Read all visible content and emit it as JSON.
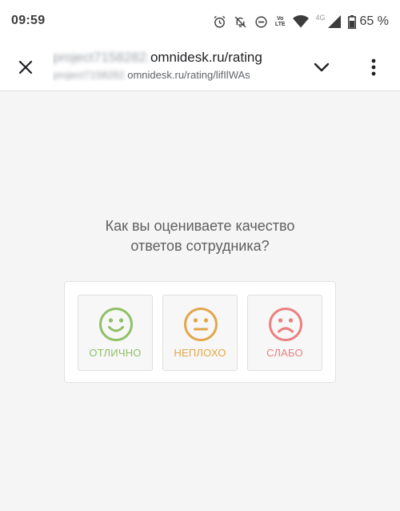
{
  "status": {
    "time": "09:59",
    "lte_top": "Vo",
    "lte_bottom": "LTE",
    "network": "4G",
    "battery": "65 %"
  },
  "toolbar": {
    "url_blurred_1": "project7158282.",
    "url_domain": "omnidesk.ru/rating",
    "url_blurred_2": "project7158282.",
    "url_path": "omnidesk.ru/rating/lifIlWAs"
  },
  "survey": {
    "question_line1": "Как вы оцениваете качество",
    "question_line2": "ответов сотрудника?",
    "options": [
      {
        "label": "ОТЛИЧНО",
        "icon": "smile-face-icon",
        "color": "#8fc066"
      },
      {
        "label": "НЕПЛОХО",
        "icon": "neutral-face-icon",
        "color": "#e2a649"
      },
      {
        "label": "СЛАБО",
        "icon": "sad-face-icon",
        "color": "#ec7f7f"
      }
    ]
  }
}
